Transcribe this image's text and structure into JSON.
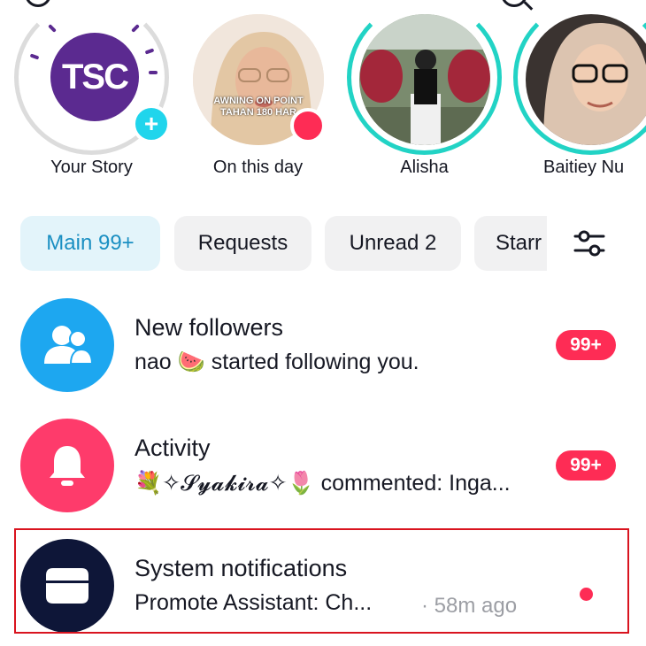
{
  "header": {
    "left_icon": "circle-icon",
    "right_icon": "search-icon"
  },
  "stories": [
    {
      "name": "Your Story",
      "avatar_icon": "tsc-logo",
      "action_icon": "plus-icon"
    },
    {
      "name": "On this day",
      "avatar_icon": "person-photo",
      "overlay_text": "AWNING ON POINT TAHAN 180 HAR"
    },
    {
      "name": "Alisha",
      "avatar_icon": "person-photo"
    },
    {
      "name": "Baitiey Nu",
      "avatar_icon": "person-photo"
    }
  ],
  "tsc_logo_text": "TSC",
  "tabs": [
    {
      "label": "Main 99+",
      "active": true
    },
    {
      "label": "Requests",
      "active": false
    },
    {
      "label": "Unread 2",
      "active": false
    },
    {
      "label": "Starr",
      "active": false
    }
  ],
  "filter_icon": "sliders-icon",
  "notifications": [
    {
      "title": "New followers",
      "subtitle": "nao 🍉 started following you.",
      "icon": "followers-icon",
      "icon_bg": "#1da7f0",
      "badge": "99+"
    },
    {
      "title": "Activity",
      "subtitle": "💐✧𝓢𝔂𝓪𝓴𝓲𝓻𝓪✧🌷 commented: Inga...",
      "icon": "bell-icon",
      "icon_bg": "#fe3b6b",
      "badge": "99+"
    },
    {
      "title": "System notifications",
      "subtitle": "Promote Assistant: Ch...",
      "time": "· 58m ago",
      "icon": "inbox-icon",
      "icon_bg": "#0e1638",
      "unread": true
    }
  ],
  "colors": {
    "accent": "#fe2c55",
    "seen_ring": "#22d3c5",
    "active_tab_text": "#1a8fc2",
    "highlight_border": "#d9141f"
  }
}
